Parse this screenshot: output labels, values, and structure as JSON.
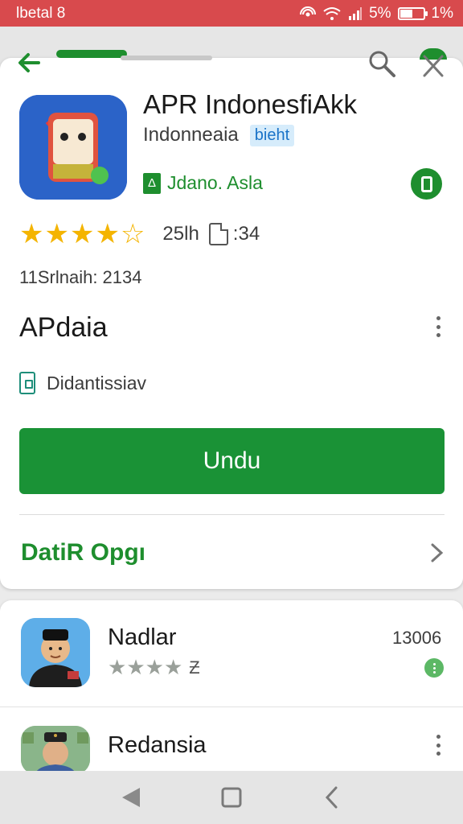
{
  "status_bar": {
    "carrier": "lbetal 8",
    "battery_percent": "5%",
    "extra": "1%",
    "battery_level": 0.55
  },
  "app": {
    "title": "APR IndonesfiAkk",
    "developer": "Indonneaia",
    "developer_badge": "bieht",
    "category": "Jdano. Asla",
    "category_icon_glyph": "Δ",
    "rating_stars": 4,
    "rating_count": "25lh",
    "size": ":34",
    "downloads": "11Srlnaih: 2134",
    "section_title": "APdaia",
    "device_text": "Didantissiav",
    "install_label": "Undu",
    "details_label": "DatiR Opgı",
    "accent_color": "#1a9236"
  },
  "related": [
    {
      "name": "Nadlar",
      "rating_text": "Ƶ",
      "stars": 4,
      "count": "13006"
    },
    {
      "name": "Redansia"
    }
  ],
  "icons": {
    "back": "arrow-left-icon",
    "search": "search-icon",
    "close": "close-icon",
    "more": "more-vert-icon",
    "nav_back": "nav-back-icon",
    "nav_home": "nav-home-icon",
    "nav_recent": "nav-recent-icon"
  }
}
